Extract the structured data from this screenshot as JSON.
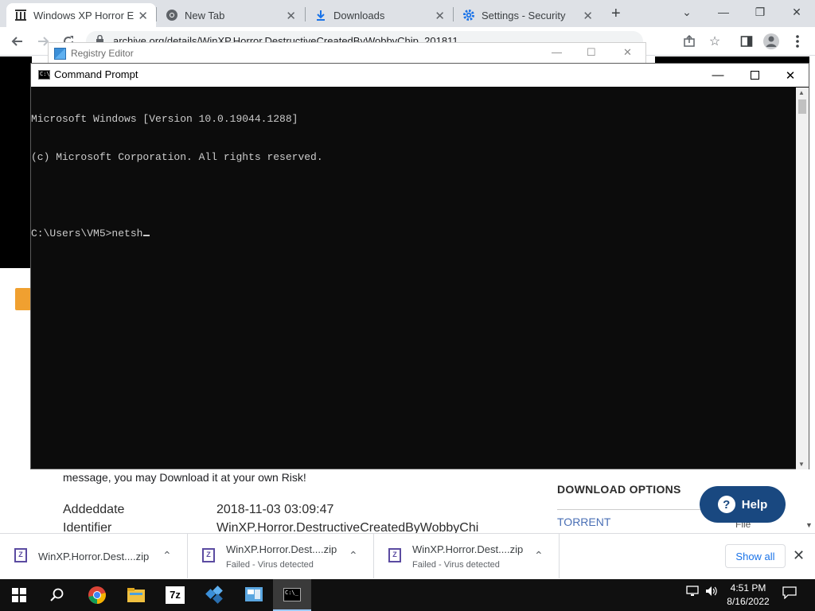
{
  "browser": {
    "tabs": [
      {
        "title": "Windows XP Horror Ed",
        "icon": "archive-icon",
        "active": true
      },
      {
        "title": "New Tab",
        "icon": "chrome-icon",
        "active": false
      },
      {
        "title": "Downloads",
        "icon": "download-icon",
        "active": false
      },
      {
        "title": "Settings - Security",
        "icon": "gear-icon",
        "active": false
      }
    ],
    "new_tab_symbol": "+",
    "url": "archive.org/details/WinXP.Horror.DestructiveCreatedByWobbyChip_201811",
    "window_controls": {
      "minimize": "—",
      "restore": "❐",
      "close": "✕",
      "chevron": "⌄"
    }
  },
  "page": {
    "info_text": "message, you may Download it at your own Risk!",
    "metadata": [
      {
        "label": "Addeddate",
        "value": "2018-11-03 03:09:47"
      },
      {
        "label": "Identifier",
        "value": "WinXP.Horror.DestructiveCreatedByWobbyChi"
      }
    ],
    "download_options_heading": "DOWNLOAD OPTIONS",
    "torrent_link": "TORRENT",
    "file_label": "File",
    "help_button": "Help",
    "help_q": "?"
  },
  "registry_editor": {
    "title": "Registry Editor"
  },
  "cmd": {
    "title": "Command Prompt",
    "lines": [
      "Microsoft Windows [Version 10.0.19044.1288]",
      "(c) Microsoft Corporation. All rights reserved.",
      "",
      "C:\\Users\\VM5>netsh"
    ]
  },
  "downloads": [
    {
      "name": "WinXP.Horror.Dest....zip",
      "status": ""
    },
    {
      "name": "WinXP.Horror.Dest....zip",
      "status": "Failed - Virus detected"
    },
    {
      "name": "WinXP.Horror.Dest....zip",
      "status": "Failed - Virus detected"
    }
  ],
  "show_all": "Show all",
  "taskbar": {
    "time": "4:51 PM",
    "date": "8/16/2022",
    "apps": [
      "windows-start-icon",
      "search-icon",
      "chrome-icon",
      "file-explorer-icon",
      "7zip-icon",
      "registry-icon",
      "control-panel-icon",
      "cmd-icon"
    ]
  },
  "colors": {
    "help_bg": "#194880",
    "link": "#4a6fb5",
    "console_bg": "#0c0c0c",
    "taskbar_bg": "#101010"
  }
}
